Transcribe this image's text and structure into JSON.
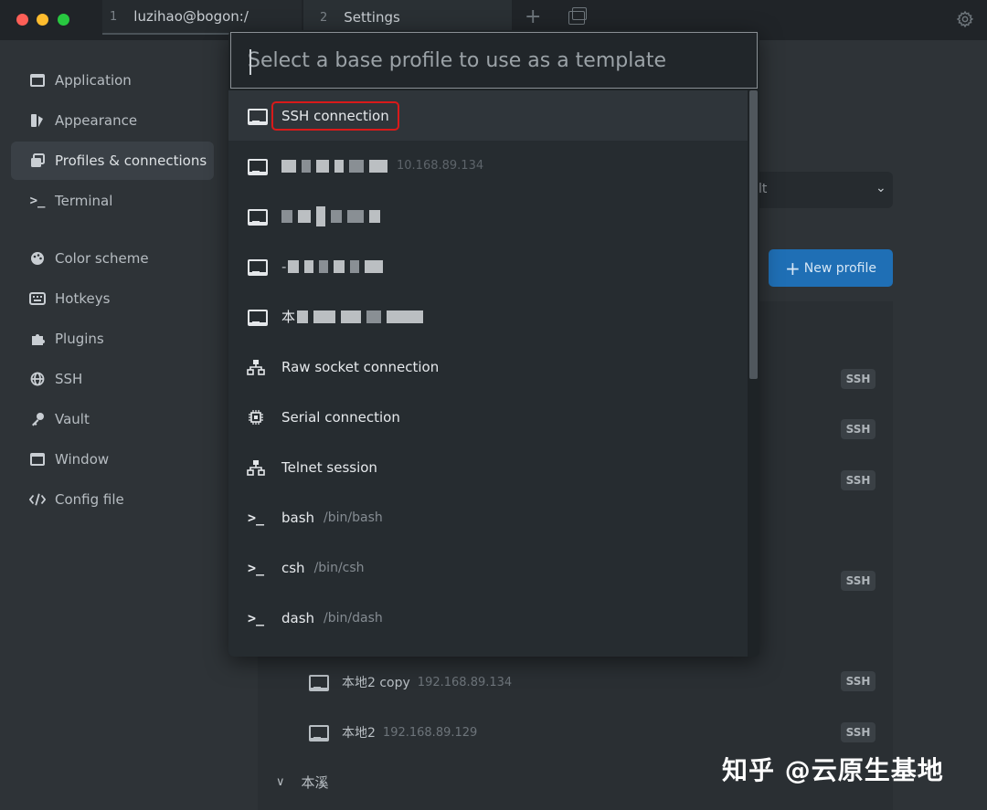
{
  "tabs": [
    {
      "num": "1",
      "label": "luzihao@bogon:/"
    },
    {
      "num": "2",
      "label": "Settings"
    }
  ],
  "sidebar": {
    "items": [
      {
        "label": "Application",
        "icon": "window-icon"
      },
      {
        "label": "Appearance",
        "icon": "brush-icon"
      },
      {
        "label": "Profiles & connections",
        "icon": "profiles-icon"
      },
      {
        "label": "Terminal",
        "icon": "terminal-icon"
      },
      {
        "label": "Color scheme",
        "icon": "palette-icon"
      },
      {
        "label": "Hotkeys",
        "icon": "keyboard-icon"
      },
      {
        "label": "Plugins",
        "icon": "puzzle-icon"
      },
      {
        "label": "SSH",
        "icon": "globe-icon"
      },
      {
        "label": "Vault",
        "icon": "key-icon"
      },
      {
        "label": "Window",
        "icon": "window-icon"
      },
      {
        "label": "Config file",
        "icon": "code-icon"
      }
    ]
  },
  "main": {
    "select_value": "lt",
    "new_profile_label": "New profile",
    "badge_label": "SSH",
    "rows": [
      {
        "name": "本地2 copy",
        "host": "192.168.89.134"
      },
      {
        "name": "本地2",
        "host": "192.168.89.129"
      }
    ],
    "group_label": "本溪"
  },
  "dropdown": {
    "placeholder": "Select a base profile to use as a template",
    "options": [
      {
        "label": "SSH connection",
        "sub": "",
        "icon": "monitor-icon"
      },
      {
        "label": "Raw socket connection",
        "sub": "",
        "icon": "network-icon"
      },
      {
        "label": "Serial connection",
        "sub": "",
        "icon": "chip-icon"
      },
      {
        "label": "Telnet session",
        "sub": "",
        "icon": "network-icon"
      },
      {
        "label": "bash",
        "sub": "/bin/bash",
        "icon": "terminal-icon"
      },
      {
        "label": "csh",
        "sub": "/bin/csh",
        "icon": "terminal-icon"
      },
      {
        "label": "dash",
        "sub": "/bin/dash",
        "icon": "terminal-icon"
      }
    ],
    "partial_host": "10.168.89.134",
    "prefix_1": "本",
    "prefix_2": "-"
  },
  "watermark": "知乎 @云原生基地"
}
